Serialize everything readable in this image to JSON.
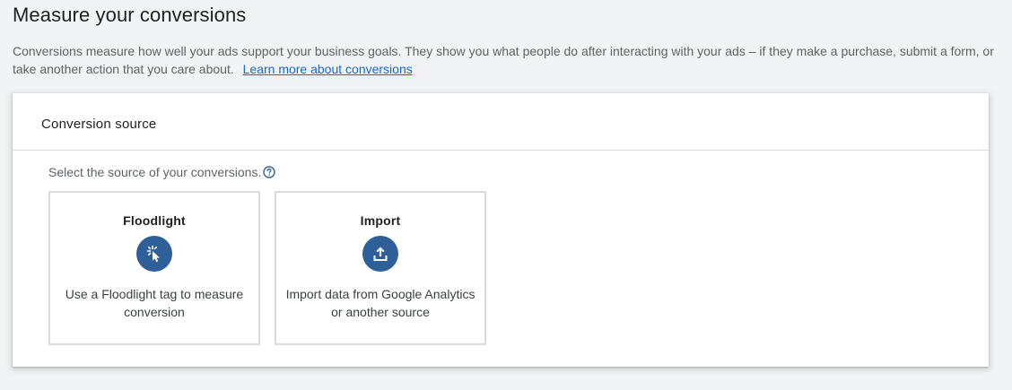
{
  "page": {
    "title": "Measure your conversions",
    "intro_text": "Conversions measure how well your ads support your business goals. They show you what people do after interacting with your ads – if they make a purchase, submit a form, or take another action that you care about.",
    "learn_more_link": "Learn more about conversions"
  },
  "card": {
    "header": "Conversion source",
    "prompt": "Select the source of your conversions.",
    "help_icon": "help-circle-icon",
    "options": [
      {
        "title": "Floodlight",
        "icon": "cursor-click-icon",
        "description": "Use a Floodlight tag to measure conversion"
      },
      {
        "title": "Import",
        "icon": "upload-icon",
        "description": "Import data from Google Analytics or another source"
      }
    ]
  },
  "colors": {
    "accent": "#2e5f99",
    "link": "#1967d2",
    "background": "#f1f3f4"
  }
}
